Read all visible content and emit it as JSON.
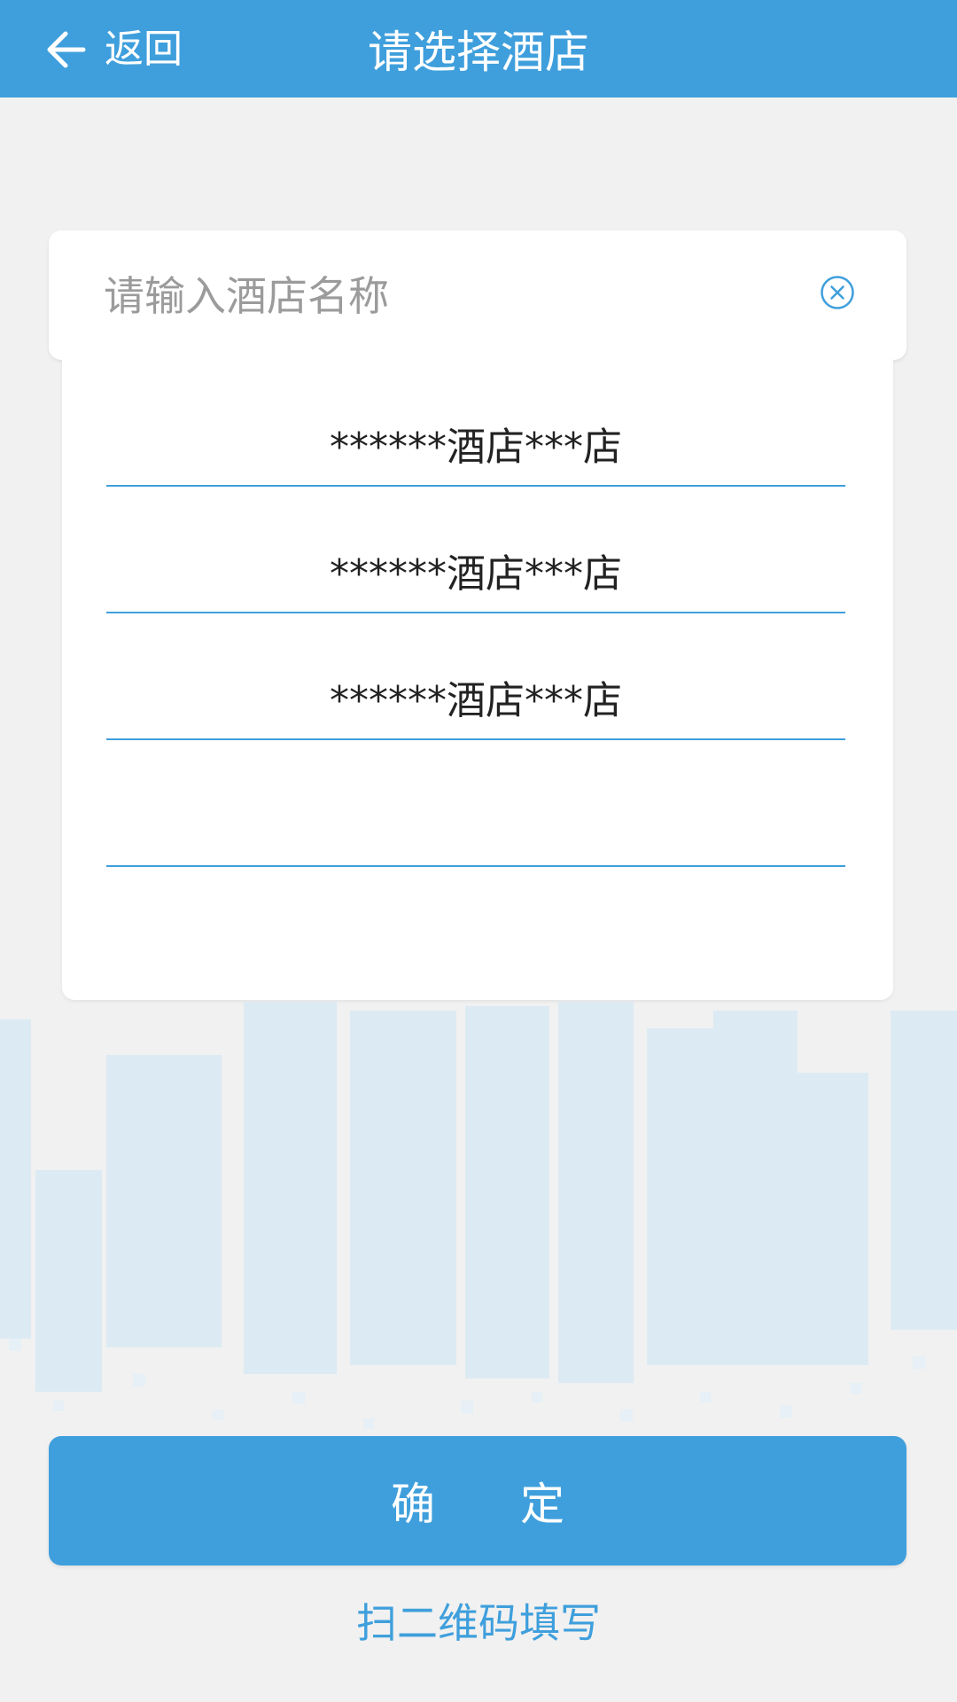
{
  "header": {
    "back_label": "返回",
    "title": "请选择酒店"
  },
  "search": {
    "placeholder": "请输入酒店名称",
    "value": ""
  },
  "hotels": [
    {
      "name": "******酒店***店"
    },
    {
      "name": "******酒店***店"
    },
    {
      "name": "******酒店***店"
    },
    {
      "name": ""
    }
  ],
  "confirm_label": "确 定",
  "scan_label": "扫二维码填写",
  "colors": {
    "accent": "#3f9fdc",
    "background": "#f1f1f1",
    "skyline": "#dceaf3"
  }
}
